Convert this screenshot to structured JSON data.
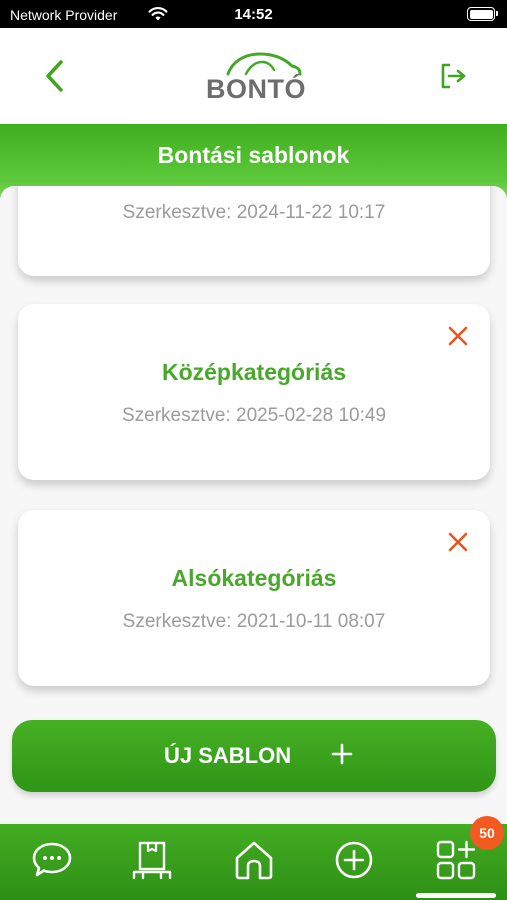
{
  "status_bar": {
    "carrier": "Network Provider",
    "time": "14:52",
    "wifi_icon": "wifi-icon",
    "battery_icon": "battery-icon"
  },
  "header": {
    "back_icon": "chevron-left-icon",
    "logo_text": "BONTÓ",
    "logout_icon": "logout-icon"
  },
  "page": {
    "title": "Bontási sablonok"
  },
  "templates": [
    {
      "name": "",
      "edited": "Szerkesztve: 2024-11-22 10:17"
    },
    {
      "name": "Középkategóriás",
      "edited": "Szerkesztve: 2025-02-28 10:49",
      "delete_icon": "close-icon"
    },
    {
      "name": "Alsókategóriás",
      "edited": "Szerkesztve: 2021-10-11 08:07",
      "delete_icon": "close-icon"
    }
  ],
  "new_button": {
    "label": "ÚJ SABLON",
    "icon": "plus-icon"
  },
  "bottom_nav": {
    "items": [
      {
        "icon": "chat-icon"
      },
      {
        "icon": "package-icon"
      },
      {
        "icon": "home-icon"
      },
      {
        "icon": "add-circle-icon"
      },
      {
        "icon": "grid-add-icon",
        "badge": "50"
      }
    ]
  },
  "colors": {
    "brand_green": "#3fa51f",
    "title_green": "#49a82b",
    "delete_orange": "#e8561c",
    "badge_orange": "#f25a20"
  }
}
